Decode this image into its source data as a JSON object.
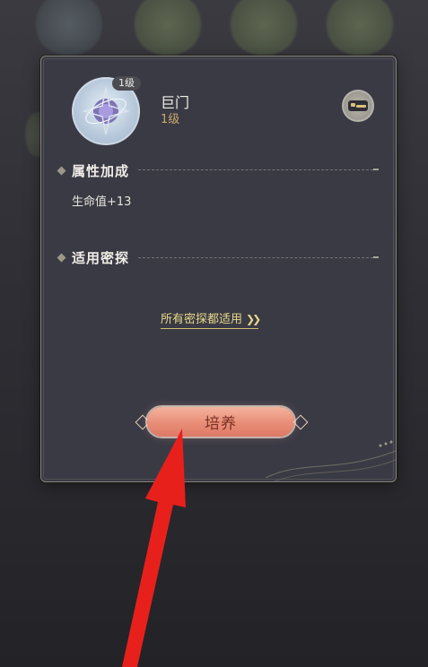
{
  "card": {
    "badge_level": "1级",
    "name": "巨门",
    "level": "1级",
    "attribute_section_title": "属性加成",
    "attribute_value": "生命值+13",
    "applicable_section_title": "适用密探",
    "applicable_link": "所有密探都适用",
    "train_button": "培养"
  },
  "icons": {
    "avatar": "star-emblem-icon",
    "top_right": "bed-icon",
    "section_marker": "diamond-icon",
    "link_chevron": "double-chevron-right-icon",
    "annotation": "red-arrow"
  },
  "colors": {
    "panel_bg": "#3a3a45",
    "accent_gold": "#c9a86a",
    "link_yellow": "#e9d889",
    "button_coral": "#e98d77",
    "arrow_red": "#e8201c"
  }
}
